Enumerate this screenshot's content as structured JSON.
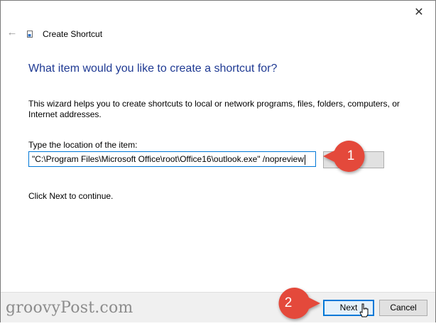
{
  "window": {
    "close_glyph": "✕",
    "back_glyph": "←",
    "title": "Create Shortcut"
  },
  "wizard": {
    "heading": "What item would you like to create a shortcut for?",
    "description": "This wizard helps you to create shortcuts to local or network programs, files, folders, computers, or Internet addresses.",
    "location_label": "Type the location of the item:",
    "location_value": "\"C:\\Program Files\\Microsoft Office\\root\\Office16\\outlook.exe\" /nopreview",
    "browse_label": "...",
    "hint": "Click Next to continue."
  },
  "footer": {
    "watermark": "groovyPost.com",
    "next_label": "Next",
    "cancel_label": "Cancel"
  },
  "callouts": [
    {
      "number": "1"
    },
    {
      "number": "2"
    }
  ],
  "colors": {
    "callout": "#e4483b",
    "heading": "#1f3a93",
    "focus": "#0078d7"
  }
}
